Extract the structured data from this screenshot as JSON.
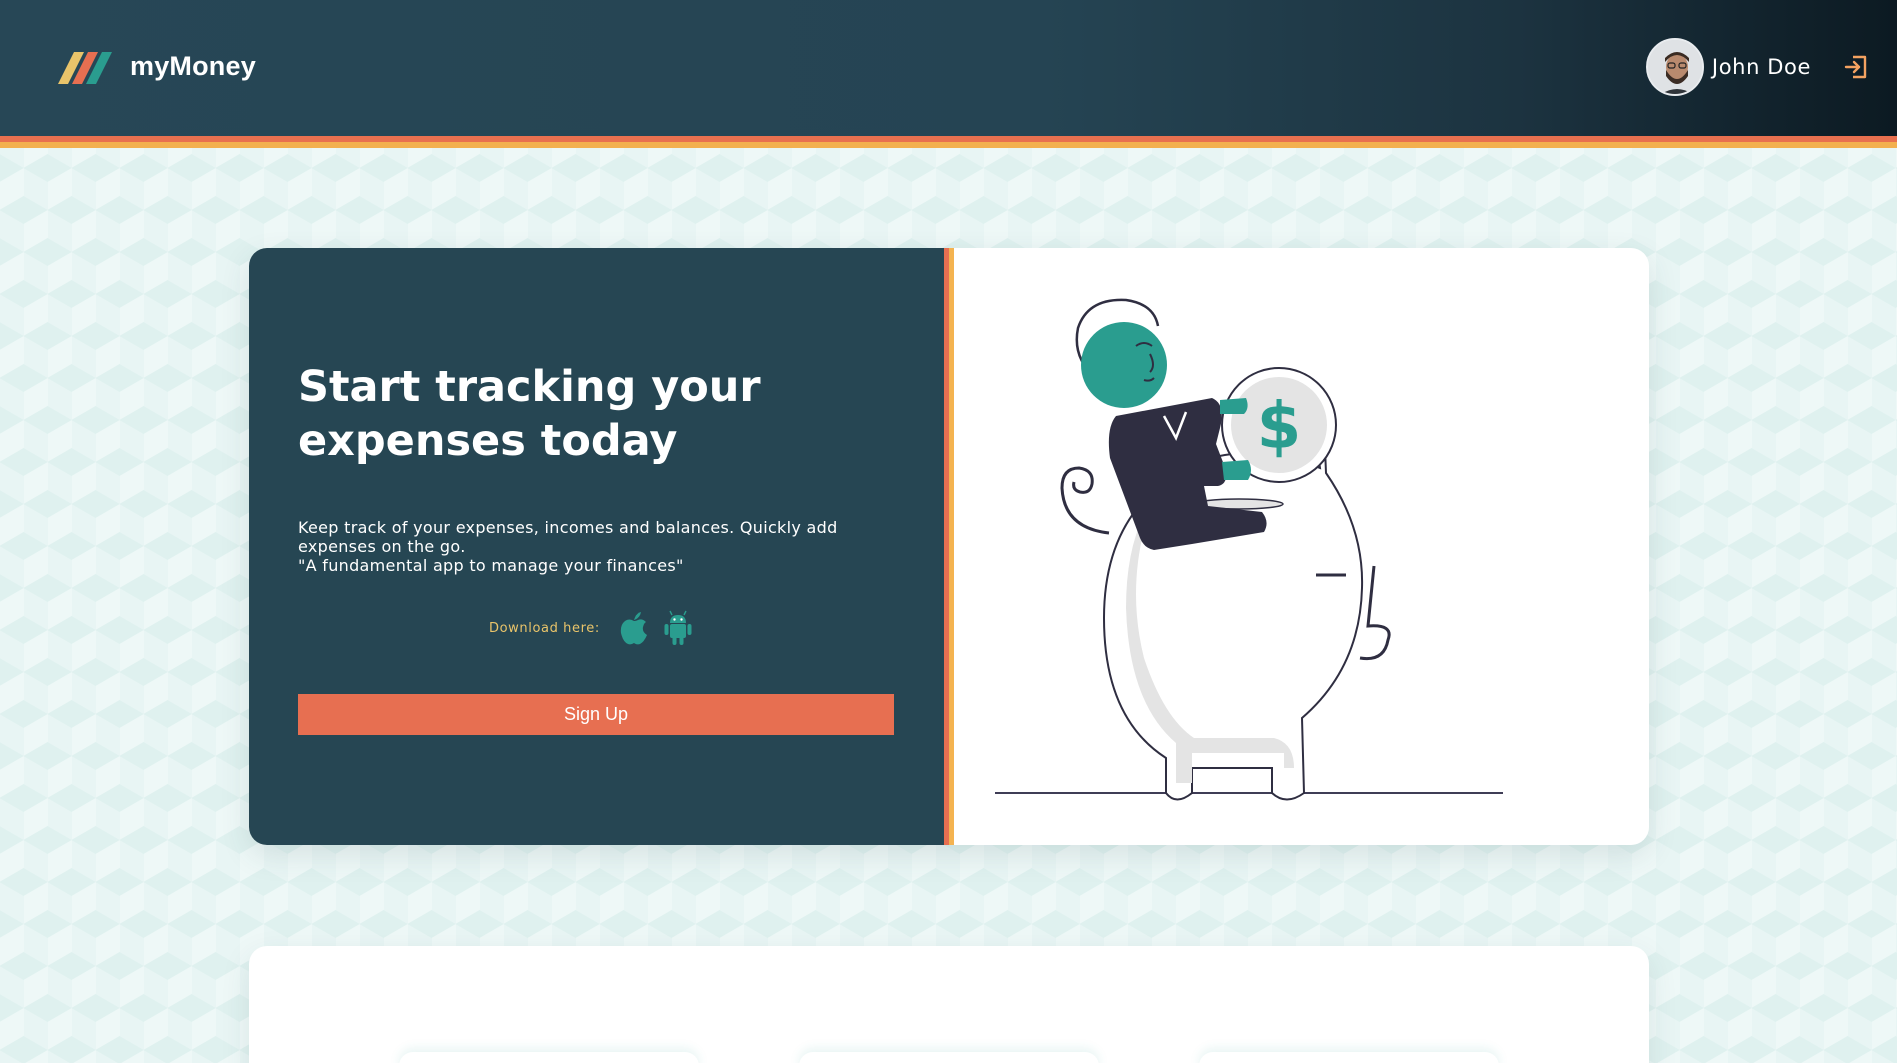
{
  "header": {
    "app_name": "myMoney",
    "logo_icon": "stripes-logo-icon",
    "user": {
      "name": "John Doe",
      "avatar_icon": "user-avatar",
      "logout_icon": "logout-icon"
    }
  },
  "hero": {
    "title": "Start tracking your expenses today",
    "description_line1": "Keep track of your expenses, incomes and balances. Quickly add expenses on the go.",
    "description_line2": "\"A fundamental app to manage your finances\"",
    "download_label": "Download here:",
    "apple_icon": "apple-icon",
    "android_icon": "android-icon",
    "signup_label": "Sign Up",
    "illustration": "piggy-bank-illustration",
    "coin_symbol": "$"
  },
  "colors": {
    "navbar": "#264653",
    "accent_orange": "#e76f51",
    "accent_yellow": "#f4b350",
    "teal": "#2a9d8f",
    "gold": "#e9c46a"
  }
}
